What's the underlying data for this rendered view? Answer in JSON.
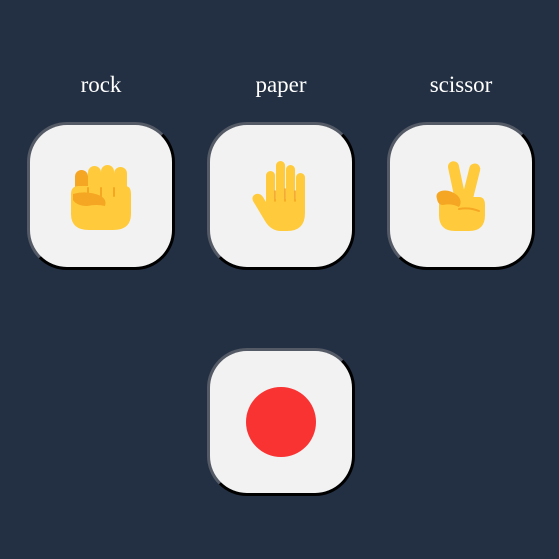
{
  "choices": [
    {
      "label": "rock",
      "icon": "raised-fist-icon"
    },
    {
      "label": "paper",
      "icon": "raised-hand-icon"
    },
    {
      "label": "scissor",
      "icon": "victory-hand-icon"
    }
  ],
  "result": {
    "icon": "red-circle-icon"
  },
  "colors": {
    "background": "#233043",
    "card": "#f2f2f2",
    "label": "#ffffff",
    "hand": "#ffcb3c",
    "hand_shade": "#f5a623",
    "result_dot": "#f93232"
  }
}
